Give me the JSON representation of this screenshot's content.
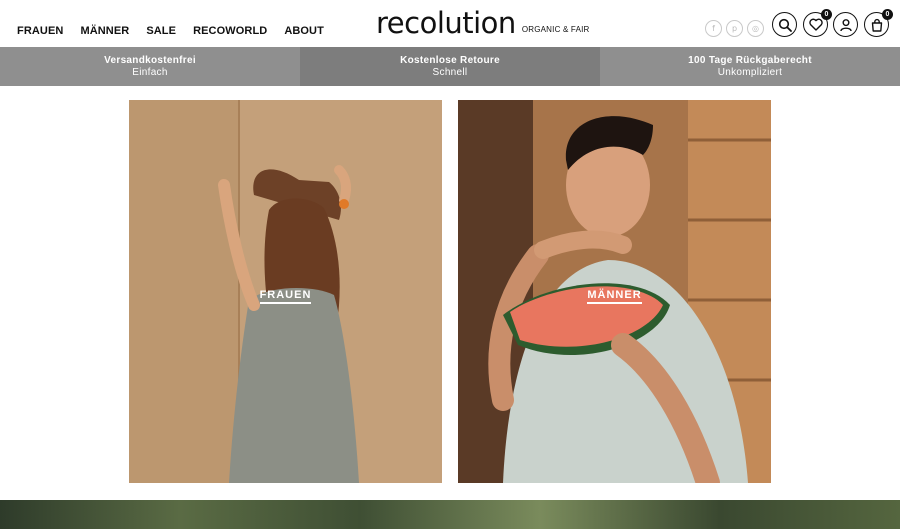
{
  "nav": {
    "items": [
      "FRAUEN",
      "MÄNNER",
      "SALE",
      "RECOWORLD",
      "ABOUT"
    ]
  },
  "logo": {
    "word": "recolution",
    "tagline": "ORGANIC & FAIR"
  },
  "social": {
    "facebook": "f",
    "pinterest": "p",
    "instagram": "◎"
  },
  "header_icons": {
    "wishlist_count": "0",
    "cart_count": "0"
  },
  "usp": [
    {
      "title": "Versandkostenfrei",
      "subtitle": "Einfach"
    },
    {
      "title": "Kostenlose Retoure",
      "subtitle": "Schnell"
    },
    {
      "title": "100 Tage Rückgaberecht",
      "subtitle": "Unkompliziert"
    }
  ],
  "tiles": {
    "women_label": "FRAUEN",
    "men_label": "MÄNNER"
  },
  "colors": {
    "usp_bg": "#8f8f8f",
    "usp_mid_bg": "#7d7d7d",
    "text": "#111111"
  }
}
